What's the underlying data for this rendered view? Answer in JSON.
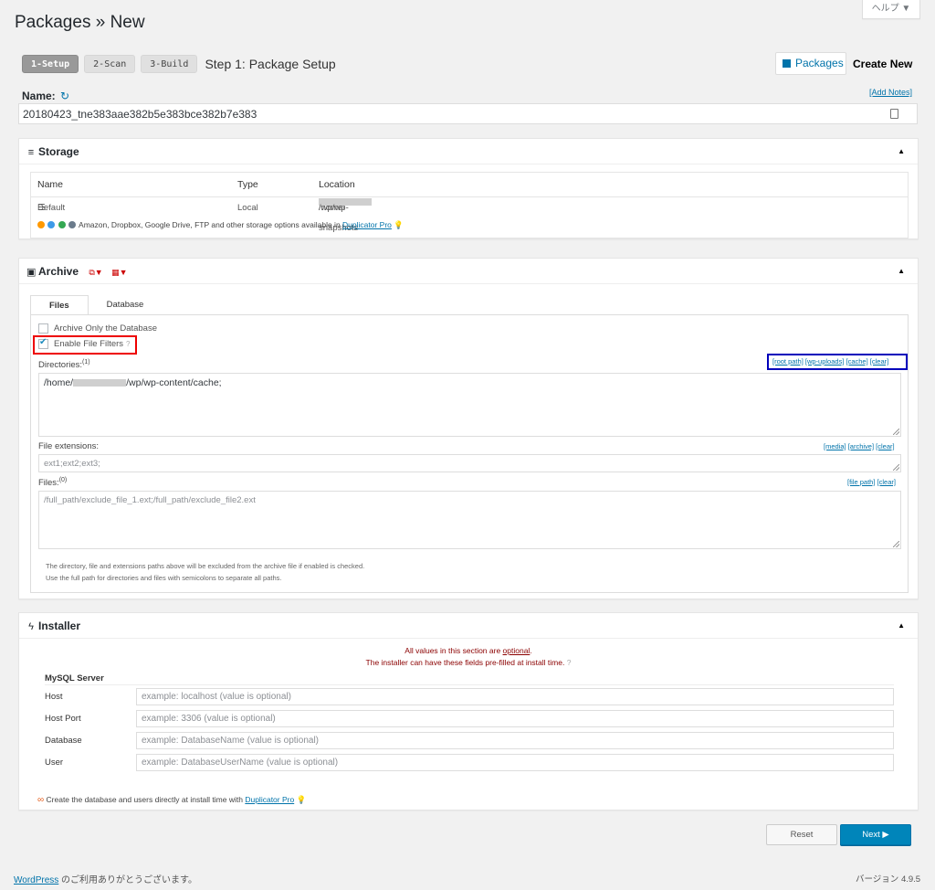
{
  "header": {
    "title": "Packages » New",
    "help_label": "ヘルプ ▼",
    "steps": [
      "1-Setup",
      "2-Scan",
      "3-Build"
    ],
    "step_title": "Step 1: Package Setup",
    "packages_button": "Packages",
    "create_new": "Create New"
  },
  "name": {
    "label": "Name:",
    "add_notes": "[Add Notes]",
    "value": "20180423_tne383aae382b5e383bce382b7e383"
  },
  "storage": {
    "title": "Storage",
    "columns": [
      "Name",
      "Type",
      "Location"
    ],
    "row": {
      "name": "Default",
      "type": "Local",
      "location_prefix": "/home/",
      "location_suffix": "/wp/wp-snapshots"
    },
    "promo_text": "Amazon, Dropbox, Google Drive, FTP and other storage options available in",
    "promo_link": "Duplicator Pro"
  },
  "archive": {
    "title": "Archive",
    "tabs": [
      "Files",
      "Database"
    ],
    "archive_only_db": "Archive Only the Database",
    "enable_filters": "Enable File Filters",
    "directories_label": "Directories:",
    "directories_count": "(1)",
    "directories_links": [
      "[root path]",
      "[wp-uploads]",
      "[cache]",
      "[clear]"
    ],
    "directories_prefix": "/home/",
    "directories_suffix": "/wp/wp-content/cache;",
    "extensions_label": "File extensions:",
    "extensions_links": [
      "[media]",
      "[archive]",
      "[clear]"
    ],
    "extensions_placeholder": "ext1;ext2;ext3;",
    "files_label": "Files:",
    "files_count": "(0)",
    "files_links": [
      "[file path]",
      "[clear]"
    ],
    "files_placeholder": "/full_path/exclude_file_1.ext;/full_path/exclude_file2.ext",
    "note_1": "The directory, file and extensions paths above will be excluded from the archive file if enabled is checked.",
    "note_2": "Use the full path for directories and files with semicolons to separate all paths."
  },
  "installer": {
    "title": "Installer",
    "msg_1_prefix": "All values in this section are ",
    "msg_1_link": "optional",
    "msg_1_suffix": ".",
    "msg_2": "The installer can have these fields pre-filled at install time.",
    "mysql_title": "MySQL Server",
    "fields": [
      {
        "label": "Host",
        "placeholder": "example: localhost (value is optional)"
      },
      {
        "label": "Host Port",
        "placeholder": "example: 3306 (value is optional)"
      },
      {
        "label": "Database",
        "placeholder": "example: DatabaseName (value is optional)"
      },
      {
        "label": "User",
        "placeholder": "example: DatabaseUserName (value is optional)"
      }
    ],
    "promo_text": "Create the database and users directly at install time with",
    "promo_link": "Duplicator Pro"
  },
  "actions": {
    "reset": "Reset",
    "next": "Next ▶"
  },
  "footer": {
    "link": "WordPress",
    "text": " のご利用ありがとうございます。",
    "version": "バージョン 4.9.5"
  },
  "colors": {
    "accent": "#0073aa",
    "primary_button": "#0085ba",
    "highlight_red": "#ee0000",
    "highlight_blue": "#0000bb"
  }
}
